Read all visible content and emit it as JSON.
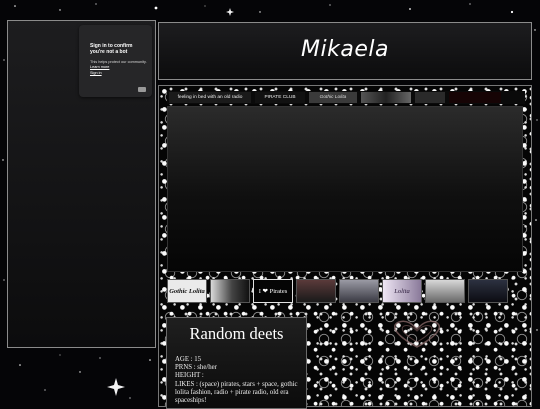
{
  "bot_check": {
    "title": "Sign in to confirm you're not a bot",
    "body": "This helps protect our community.",
    "learn_more": "Learn more",
    "sign_in": "Sign in"
  },
  "header": {
    "name": "Mikaela"
  },
  "banners": [
    {
      "label": "",
      "text": "feeling in bed with an old radio"
    },
    {
      "label": "",
      "text": "PIRATE CLUB"
    },
    {
      "label": "",
      "text": "Gothic Lolita"
    },
    {
      "label": "",
      "text": ""
    },
    {
      "label": "",
      "text": ""
    },
    {
      "label": "",
      "text": ""
    }
  ],
  "buttons": [
    {
      "text": "Gothic Lolita"
    },
    {
      "text": ""
    },
    {
      "text": "I ❤ Pirates"
    },
    {
      "text": ""
    },
    {
      "text": ""
    },
    {
      "text": "Lolita"
    },
    {
      "text": ""
    },
    {
      "text": ""
    }
  ],
  "deets": {
    "title": "Random deets",
    "lines": [
      "AGE : 15",
      "PRNS : she/her",
      "HEIGHT :",
      "LIKES : (space) pirates, stars + space, gothic lolita fashion, radio + pirate radio, old era spaceships!"
    ]
  },
  "colors": {
    "accent_red": "#ff4b5a",
    "panel_border": "#8b8b8b"
  },
  "icons": [
    "heart-decoration-icon"
  ]
}
